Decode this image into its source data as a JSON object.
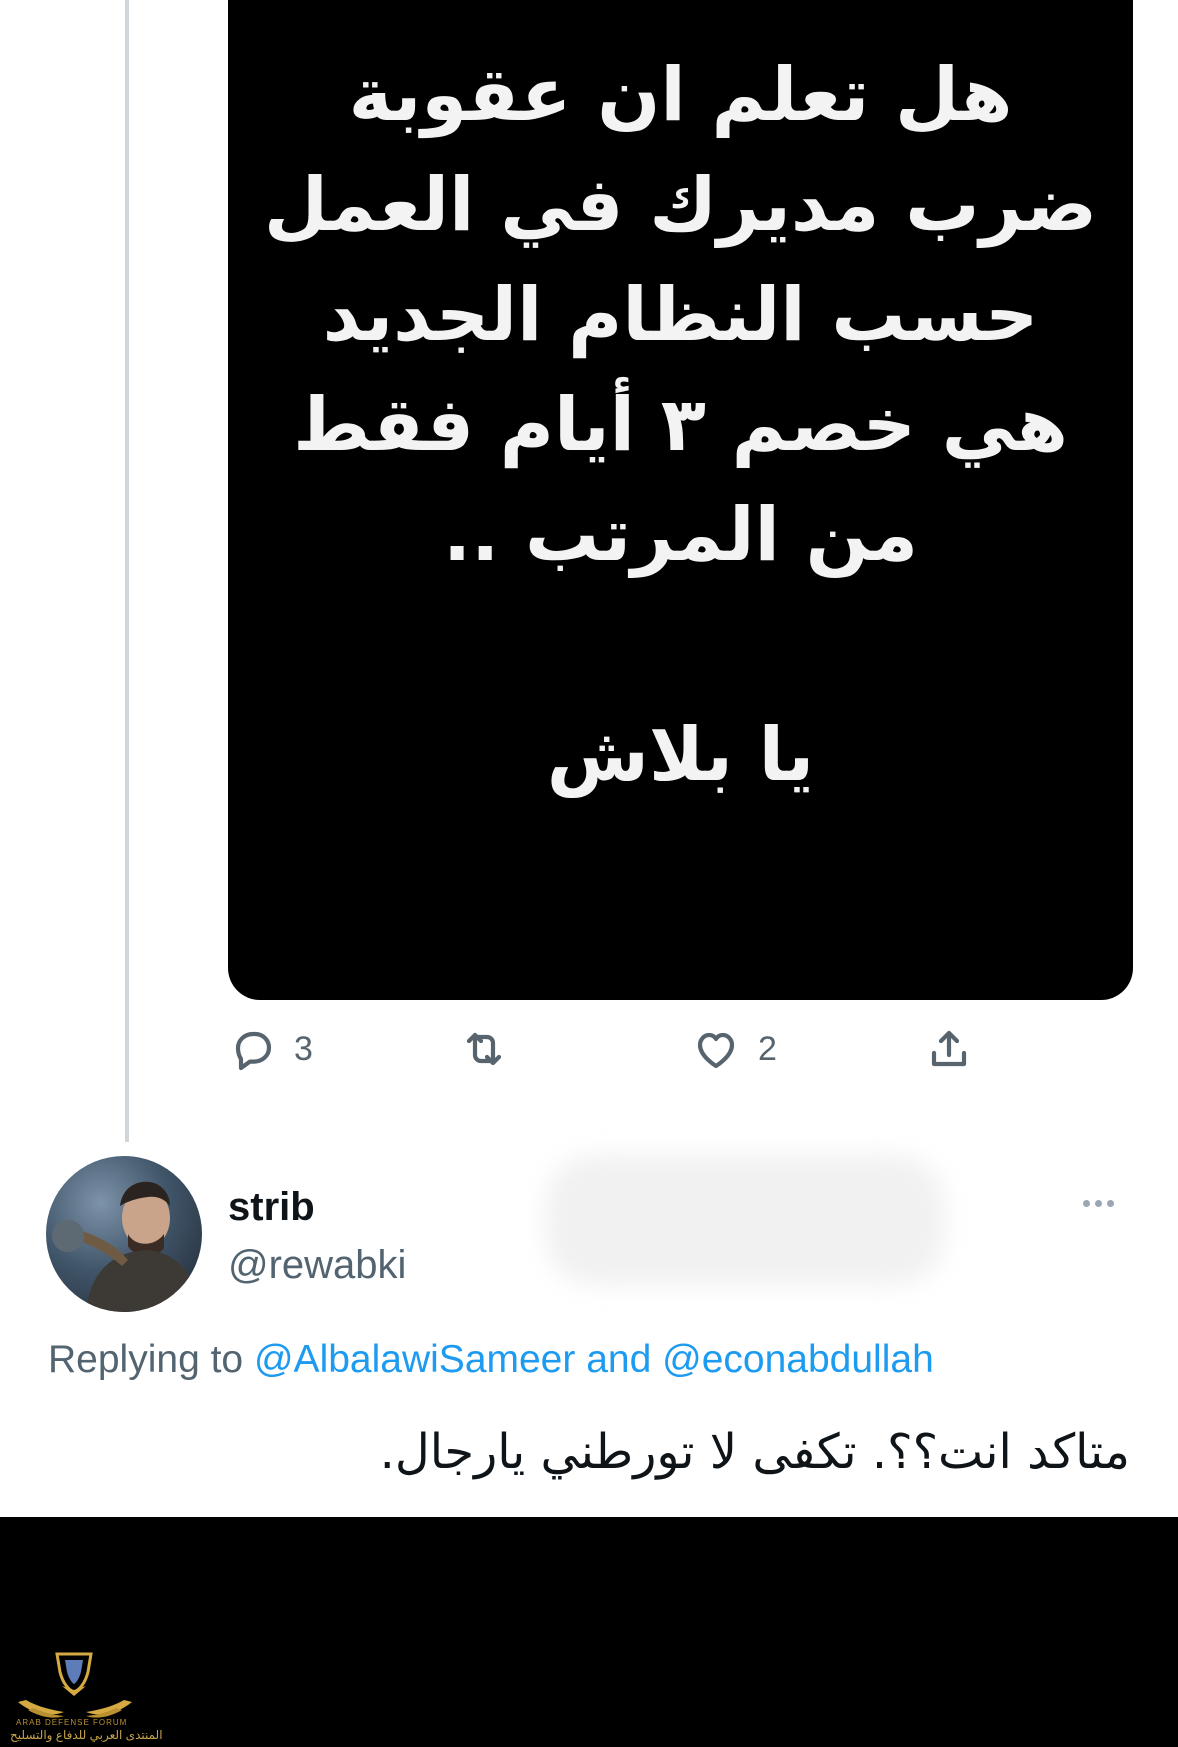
{
  "media": {
    "lines": [
      "هل تعلم ان عقوبة",
      "ضرب مديرك في العمل",
      "حسب النظام الجديد",
      "هي خصم ٣ أيام فقط",
      "من المرتب ..",
      "يا بلاش"
    ]
  },
  "actions": {
    "reply_count": "3",
    "like_count": "2"
  },
  "reply": {
    "name": "strib",
    "handle": "@rewabki",
    "replying_prefix": "Replying to",
    "mention_1": "@AlbalawiSameer",
    "conjunction": "and",
    "mention_2": "@econabdullah",
    "text": "متاكد انت؟؟. تكفى لا تورطني يارجال."
  },
  "watermark": {
    "text_en": "ARAB DEFENSE FORUM",
    "text_ar": "المنتدى العربي للدفاع والتسليح"
  },
  "colors": {
    "accent_link": "#1d9bf0",
    "muted_text": "#536471",
    "primary_text": "#0f1419",
    "media_bg": "#000000"
  },
  "icons": [
    "reply-icon",
    "retweet-icon",
    "like-icon",
    "share-icon",
    "more-icon"
  ]
}
